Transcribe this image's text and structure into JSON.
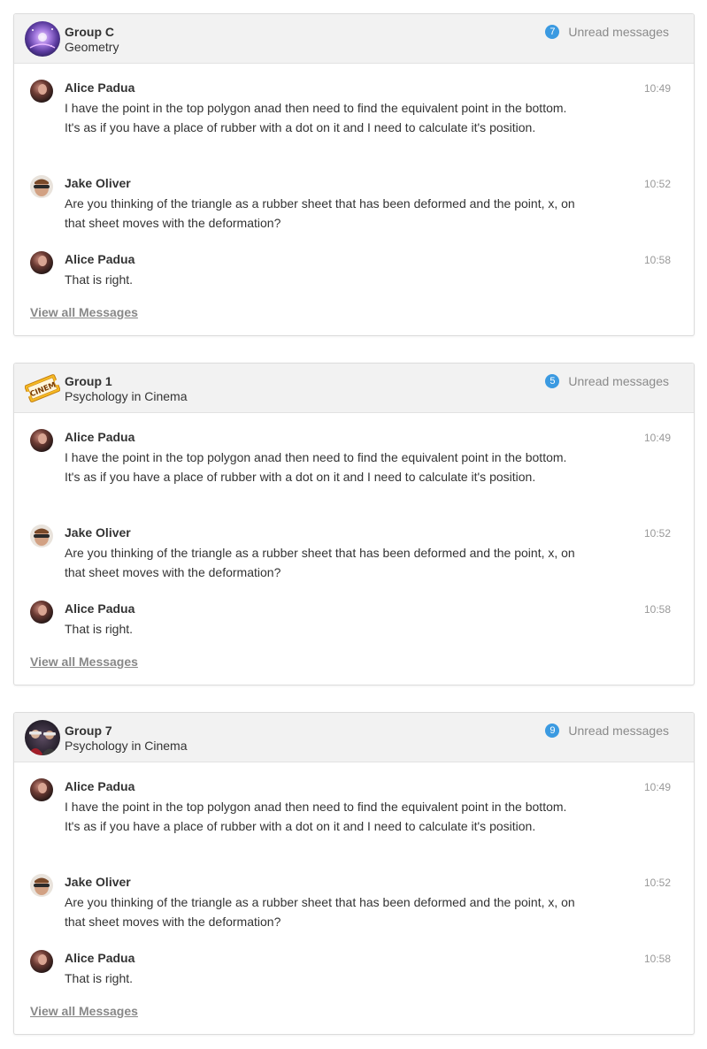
{
  "view_all_label": "View all Messages",
  "unread_label": "Unread messages",
  "colors": {
    "badge": "#3b9ae1",
    "header_bg": "#f2f2f2"
  },
  "cards": [
    {
      "group_name": "Group C",
      "subject": "Geometry",
      "unread_count": "7",
      "avatar_icon": "galaxy-image",
      "messages": [
        {
          "author": "Alice Padua",
          "time": "10:49",
          "text": "I have the point in the top polygon anad then need to find the equivalent point in the bottom. It's as if you have a place of rubber with a dot on it and I need to calculate it's position."
        },
        {
          "author": "Jake Oliver",
          "time": "10:52",
          "text": "Are you thinking of the triangle as a rubber sheet that has been deformed and the point, x, on that sheet moves with the deformation?"
        },
        {
          "author": "Alice Padua",
          "time": "10:58",
          "text": "That is right."
        }
      ]
    },
    {
      "group_name": "Group 1",
      "subject": "Psychology in Cinema",
      "unread_count": "5",
      "avatar_icon": "cinema-ticket-image",
      "avatar_text": "CINEM",
      "messages": [
        {
          "author": "Alice Padua",
          "time": "10:49",
          "text": "I have the point in the top polygon anad then need to find the equivalent point in the bottom. It's as if you have a place of rubber with a dot on it and I need to calculate it's position."
        },
        {
          "author": "Jake Oliver",
          "time": "10:52",
          "text": "Are you thinking of the triangle as a rubber sheet that has been deformed and the point, x, on that sheet moves with the deformation?"
        },
        {
          "author": "Alice Padua",
          "time": "10:58",
          "text": "That is right."
        }
      ]
    },
    {
      "group_name": "Group 7",
      "subject": "Psychology in Cinema",
      "unread_count": "9",
      "avatar_icon": "cinema-audience-image",
      "messages": [
        {
          "author": "Alice Padua",
          "time": "10:49",
          "text": "I have the point in the top polygon anad then need to find the equivalent point in the bottom. It's as if you have a place of rubber with a dot on it and I need to calculate it's position."
        },
        {
          "author": "Jake Oliver",
          "time": "10:52",
          "text": "Are you thinking of the triangle as a rubber sheet that has been deformed and the point, x, on that sheet moves with the deformation?"
        },
        {
          "author": "Alice Padua",
          "time": "10:58",
          "text": "That is right."
        }
      ]
    }
  ]
}
